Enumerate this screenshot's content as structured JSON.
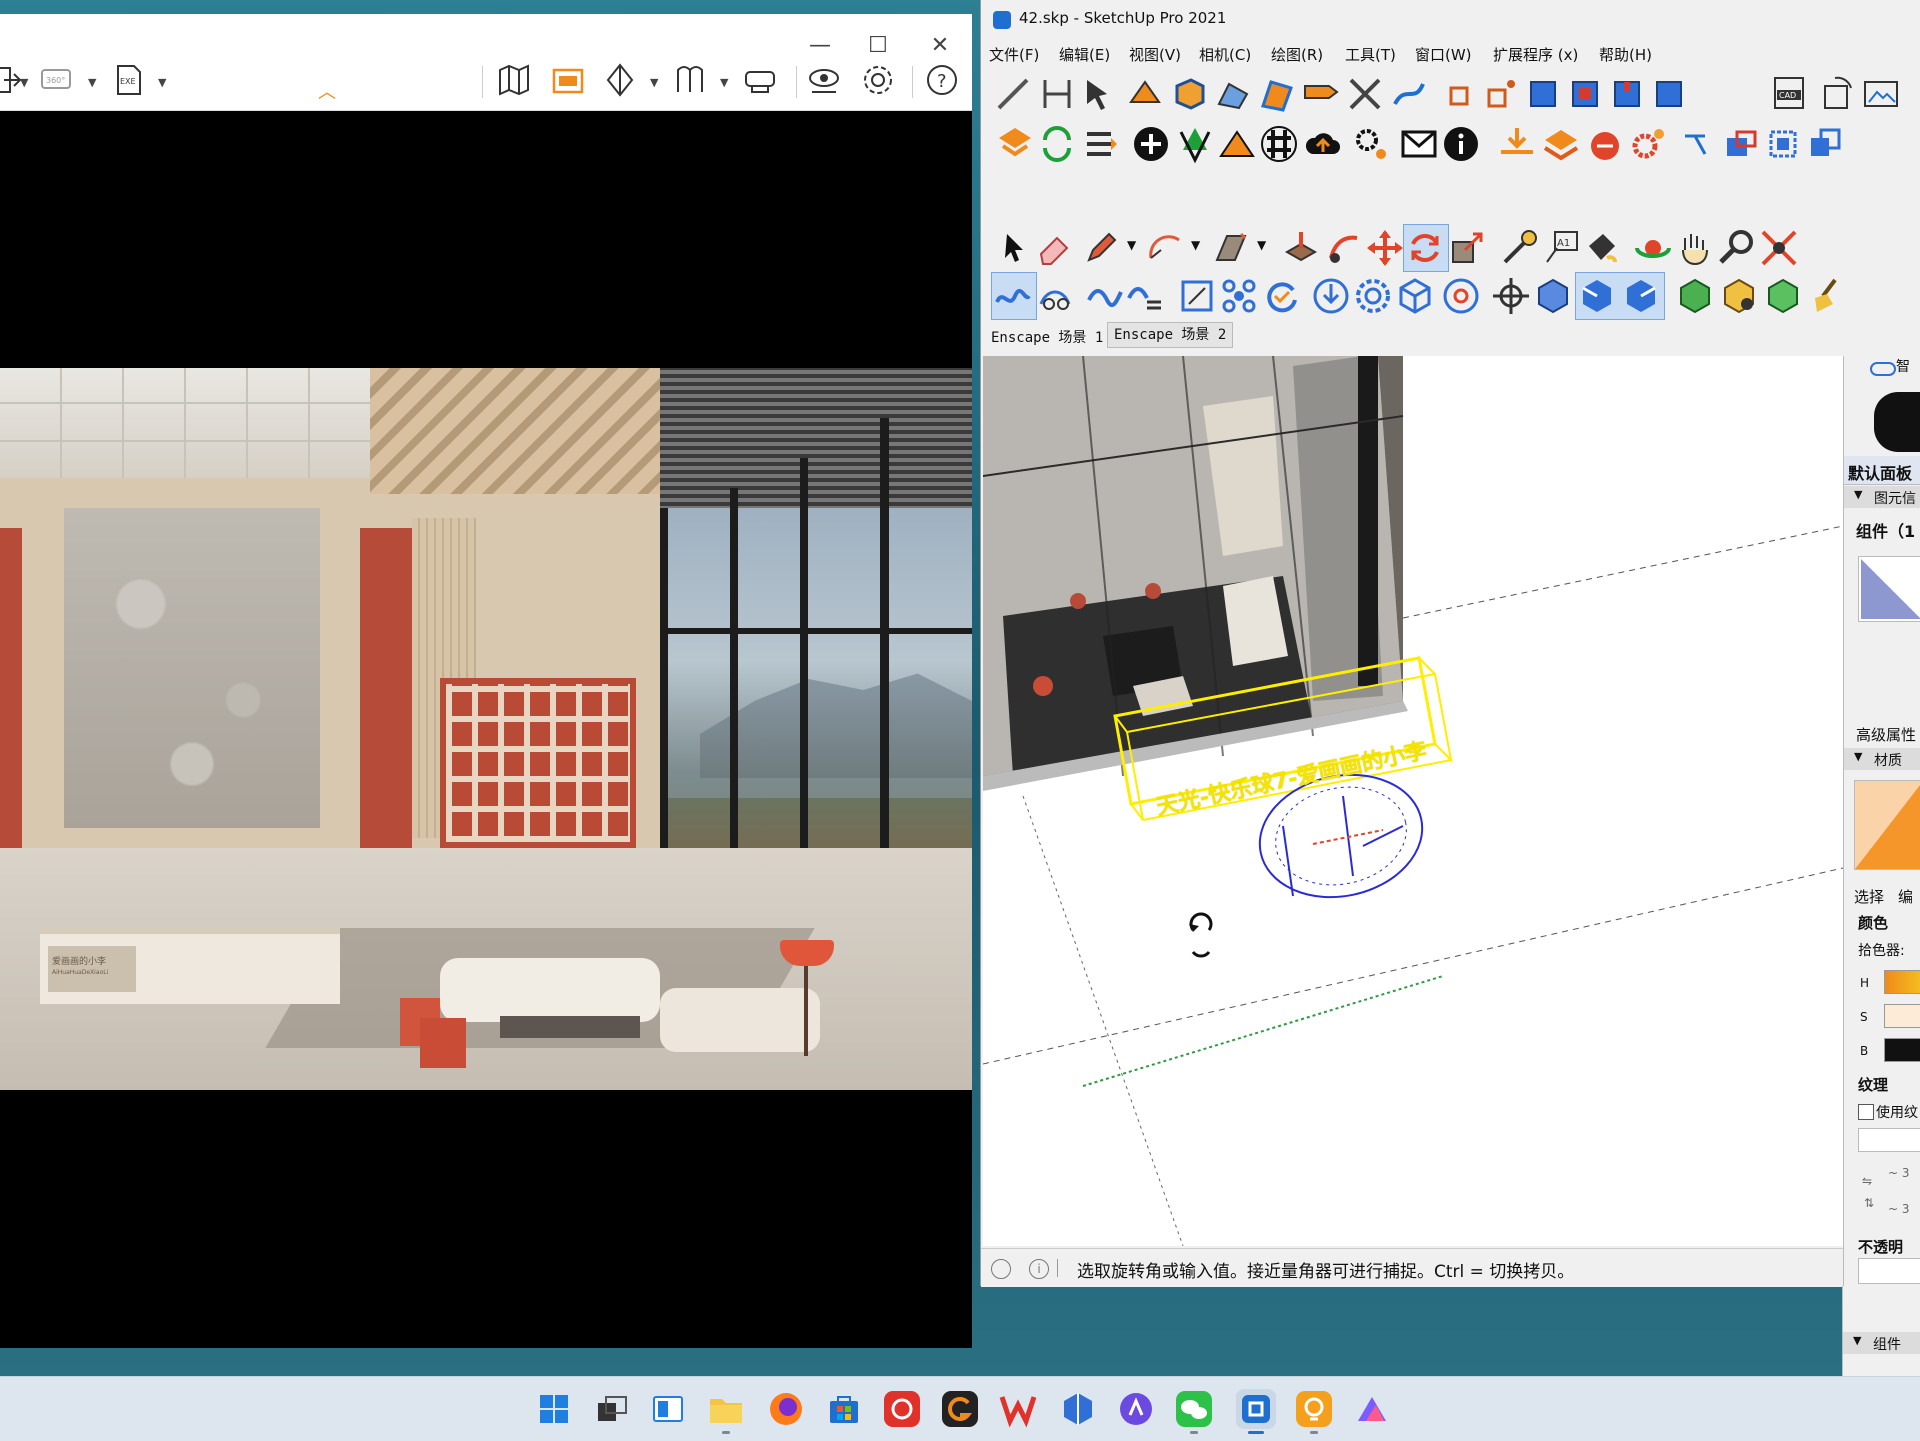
{
  "sketchup": {
    "window_title": "42.skp - SketchUp Pro 2021",
    "menu": [
      "文件(F)",
      "编辑(E)",
      "视图(V)",
      "相机(C)",
      "绘图(R)",
      "工具(T)",
      "窗口(W)",
      "扩展程序 (x)",
      "帮助(H)"
    ],
    "scene_tabs": [
      "Enscape 场景 1",
      "Enscape 场景 2"
    ],
    "status_text": "选取旋转角或输入值。接近量角器可进行捕捉。Ctrl = 切换拷贝。",
    "model_text": "天光-快乐球7-爱画画的小李",
    "toolbar_badge": "CAD",
    "tray": {
      "default_panel": "默认面板",
      "entity_info": "图元信",
      "component": "组件（1",
      "advanced": "高级属性",
      "materials": "材质",
      "select_tab": "选择",
      "edit_tab": "编",
      "color": "颜色",
      "picker": "拾色器:",
      "h": "H",
      "s": "S",
      "b": "B",
      "texture": "纹理",
      "use_texture": "使用纹",
      "dim1": "~ 3",
      "dim2": "~ 3",
      "opacity": "不透明",
      "components_section": "组件"
    }
  },
  "enscape": {
    "toolbar_360_label": "360°",
    "toolbar_exe_label": "EXE",
    "sign_line1": "爱画画的小李",
    "sign_line2": "AiHuaHuaDeXiaoLi"
  },
  "colors": {
    "selection": "#ffee00",
    "protractor": "#2b2bd6",
    "accent_orange": "#f08a1c",
    "sketchup_blue": "#1f6fd1"
  }
}
